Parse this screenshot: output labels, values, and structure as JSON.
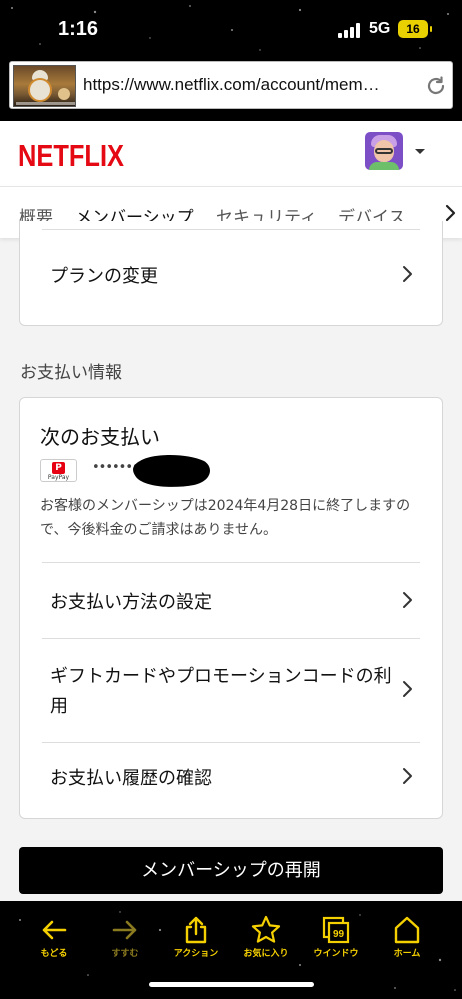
{
  "status_bar": {
    "time": "1:16",
    "network": "5G",
    "battery": "16"
  },
  "browser": {
    "url": "https://www.netflix.com/account/mem…"
  },
  "netflix": {
    "logo_text": "NETFLIX",
    "brand_color": "#e50914",
    "tabs": [
      {
        "label": "概要"
      },
      {
        "label": "メンバーシップ"
      },
      {
        "label": "セキュリティ"
      },
      {
        "label": "デバイス"
      }
    ],
    "active_tab": "メンバーシップ"
  },
  "membership": {
    "change_plan_label": "プランの変更"
  },
  "payment": {
    "section_title": "お支払い情報",
    "next_payment_title": "次のお支払い",
    "method_logo_text": "PayPay",
    "method_logo_mark": "P",
    "masked_account": "••••••••",
    "note": "お客様のメンバーシップは2024年4月28日に終了しますので、今後料金のご請求はありません。",
    "links": [
      {
        "label": "お支払い方法の設定"
      },
      {
        "label": "ギフトカードやプロモーションコードの利用"
      },
      {
        "label": "お支払い履歴の確認"
      }
    ]
  },
  "resume_button_label": "メンバーシップの再開",
  "toolbar": {
    "items": [
      {
        "label": "もどる",
        "icon": "back-arrow-icon"
      },
      {
        "label": "すすむ",
        "icon": "forward-arrow-icon"
      },
      {
        "label": "アクション",
        "icon": "share-icon"
      },
      {
        "label": "お気に入り",
        "icon": "star-icon"
      },
      {
        "label": "ウインドウ",
        "icon": "windows-icon",
        "badge": "99"
      },
      {
        "label": "ホーム",
        "icon": "home-icon"
      }
    ],
    "accent": "#f5d000"
  }
}
